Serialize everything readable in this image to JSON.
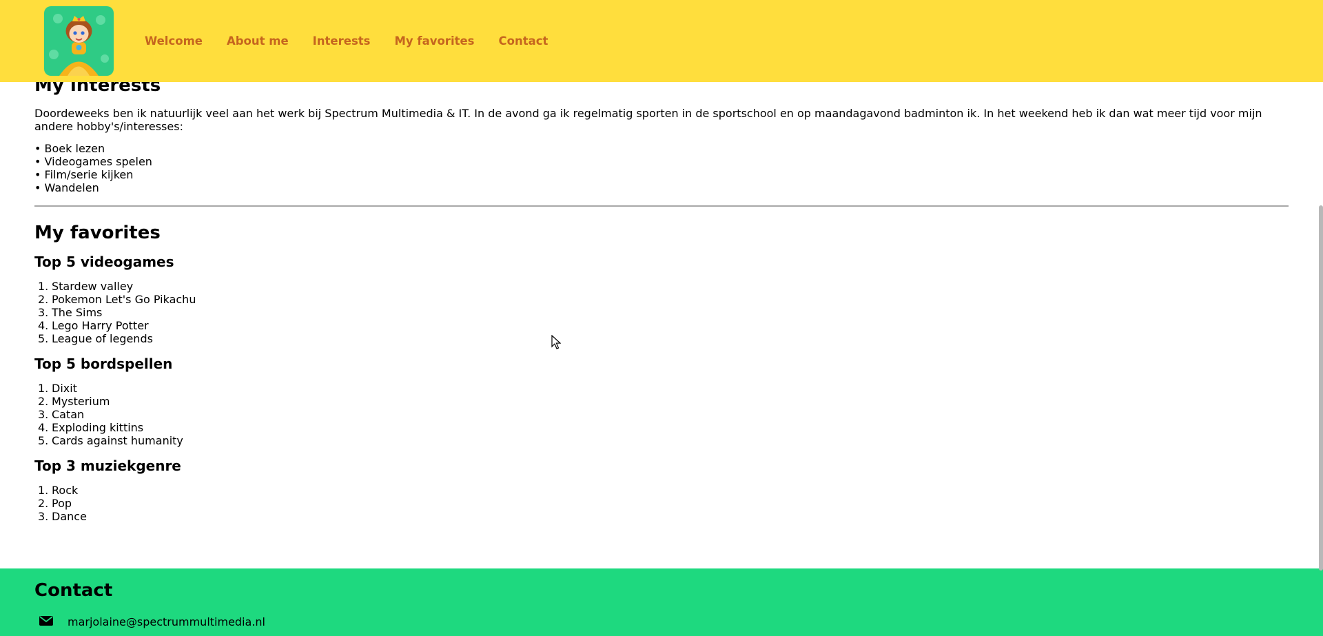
{
  "nav": {
    "items": [
      "Welcome",
      "About me",
      "Interests",
      "My favorites",
      "Contact"
    ],
    "color": "#c5651e",
    "background": "#ffde3d"
  },
  "interests": {
    "title": "My interests",
    "text": "Doordeweeks ben ik natuurlijk veel aan het werk bij Spectrum Multimedia & IT. In de avond ga ik regelmatig sporten in de sportschool en op maandagavond badminton ik. In het weekend heb ik dan wat meer tijd voor mijn andere hobby's/interesses:",
    "hobbies": [
      "Boek lezen",
      "Videogames spelen",
      "Film/serie kijken",
      "Wandelen"
    ]
  },
  "favorites": {
    "title": "My favorites",
    "games": {
      "title": "Top 5 videogames",
      "items": [
        "Stardew valley",
        "Pokemon Let's Go Pikachu",
        "The Sims",
        "Lego Harry Potter",
        "League of legends"
      ]
    },
    "boardgames": {
      "title": "Top 5 bordspellen",
      "items": [
        "Dixit",
        "Mysterium",
        "Catan",
        "Exploding kittins",
        "Cards against humanity"
      ]
    },
    "music": {
      "title": "Top 3 muziekgenre",
      "items": [
        "Rock",
        "Pop",
        "Dance"
      ]
    }
  },
  "contact": {
    "title": "Contact",
    "email": "marjolaine@spectrummultimedia.nl",
    "icon": "envelope-icon",
    "background": "#1ed97f"
  }
}
